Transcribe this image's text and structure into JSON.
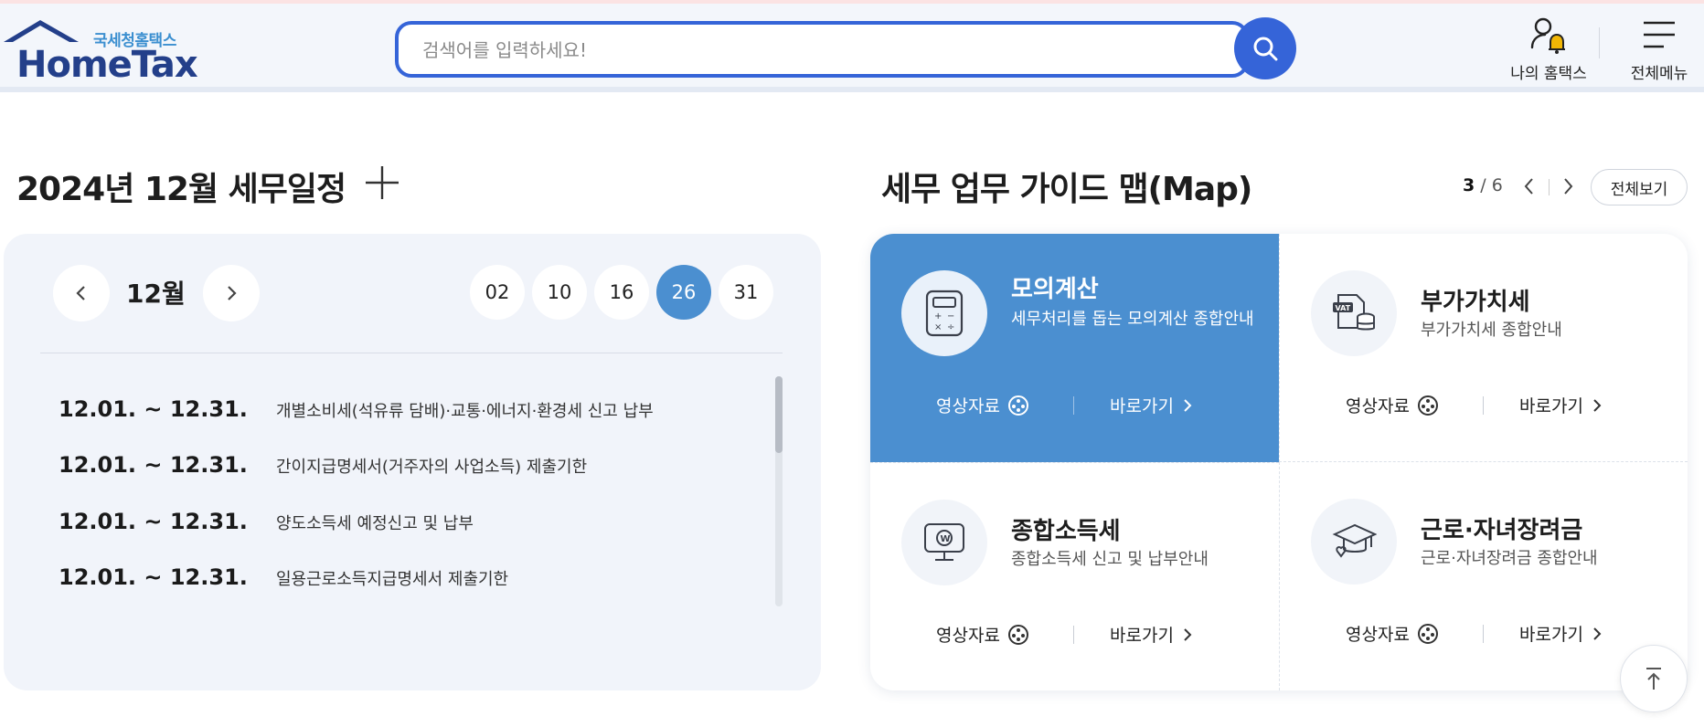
{
  "header": {
    "logo_sub": "국세청홈택스",
    "logo_main": "HomeTax",
    "search_placeholder": "검색어를 입력하세요!",
    "my_hometax": "나의 홈택스",
    "all_menu": "전체메뉴"
  },
  "schedule": {
    "title": "2024년 12월 세무일정",
    "month": "12월",
    "days": [
      "02",
      "10",
      "16",
      "26",
      "31"
    ],
    "active_day": "26",
    "items": [
      {
        "date": "12.01. ~ 12.31.",
        "desc": "개별소비세(석유류 담배)·교통·에너지·환경세 신고 납부"
      },
      {
        "date": "12.01. ~ 12.31.",
        "desc": "간이지급명세서(거주자의 사업소득) 제출기한"
      },
      {
        "date": "12.01. ~ 12.31.",
        "desc": "양도소득세 예정신고 및 납부"
      },
      {
        "date": "12.01. ~ 12.31.",
        "desc": "일용근로소득지급명세서 제출기한"
      }
    ]
  },
  "guide_map": {
    "title": "세무 업무 가이드 맵(Map)",
    "page_current": "3",
    "page_total": " / 6",
    "view_all": "전체보기",
    "cards": [
      {
        "title": "모의계산",
        "desc": "세무처리를 돕는 모의계산 종합안내",
        "video": "영상자료",
        "go": "바로가기",
        "icon": "calculator-icon"
      },
      {
        "title": "부가가치세",
        "desc": "부가가치세 종합안내",
        "video": "영상자료",
        "go": "바로가기",
        "icon": "vat-icon"
      },
      {
        "title": "종합소득세",
        "desc": "종합소득세 신고 및 납부안내",
        "video": "영상자료",
        "go": "바로가기",
        "icon": "monitor-won-icon"
      },
      {
        "title": "근로·자녀장려금",
        "desc": "근로·자녀장려금 종합안내",
        "video": "영상자료",
        "go": "바로가기",
        "icon": "graduation-cap-icon"
      }
    ]
  },
  "colors": {
    "accent": "#3564d8",
    "card_active": "#4b8fd0",
    "panel": "#f1f4fa"
  }
}
